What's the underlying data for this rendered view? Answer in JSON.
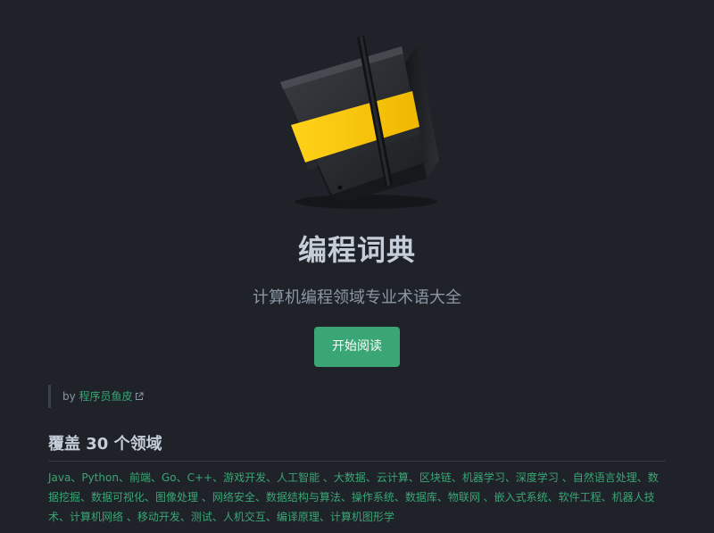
{
  "hero": {
    "title": "编程词典",
    "tagline": "计算机编程领域专业术语大全",
    "start_button": "开始阅读"
  },
  "author": {
    "prefix": "by ",
    "link_text": "程序员鱼皮",
    "icon": "external-link-icon"
  },
  "section": {
    "title": "覆盖 30 个领域",
    "domains_text": "Java、Python、前端、Go、C++、游戏开发、人工智能 、大数据、云计算、区块链、机器学习、深度学习 、自然语言处理、数据挖掘、数据可视化、图像处理 、网络安全、数据结构与算法、操作系统、数据库、物联网 、嵌入式系统、软件工程、机器人技术、计算机网络 、移动开发、测试、人机交互、编译原理、计算机图形学"
  },
  "colors": {
    "background": "#1f2228",
    "accent": "#3aa675",
    "book_body": "#2b2e33",
    "book_band": "#f5c400"
  }
}
